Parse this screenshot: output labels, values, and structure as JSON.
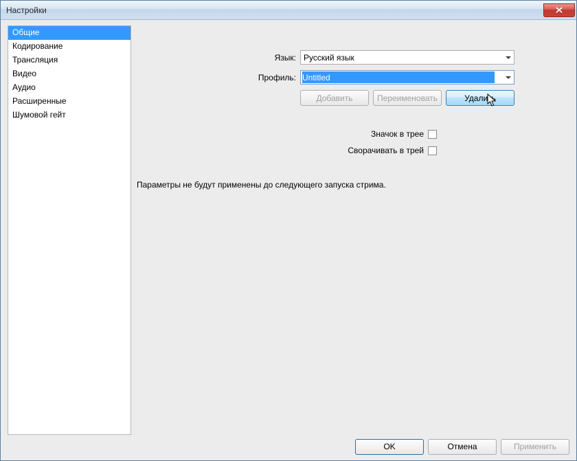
{
  "window": {
    "title": "Настройки"
  },
  "sidebar": {
    "items": [
      {
        "label": "Общие",
        "selected": true
      },
      {
        "label": "Кодирование",
        "selected": false
      },
      {
        "label": "Трансляция",
        "selected": false
      },
      {
        "label": "Видео",
        "selected": false
      },
      {
        "label": "Аудио",
        "selected": false
      },
      {
        "label": "Расширенные",
        "selected": false
      },
      {
        "label": "Шумовой гейт",
        "selected": false
      }
    ]
  },
  "form": {
    "language_label": "Язык:",
    "language_value": "Русский язык",
    "profile_label": "Профиль:",
    "profile_value": "Untitled",
    "add_label": "Добавить",
    "rename_label": "Переименовать",
    "delete_label": "Удалить",
    "tray_icon_label": "Значок в трее",
    "minimize_tray_label": "Сворачивать в трей",
    "note_text": "Параметры не будут применены до следующего запуска стрима."
  },
  "footer": {
    "ok_label": "OK",
    "cancel_label": "Отмена",
    "apply_label": "Применить"
  }
}
